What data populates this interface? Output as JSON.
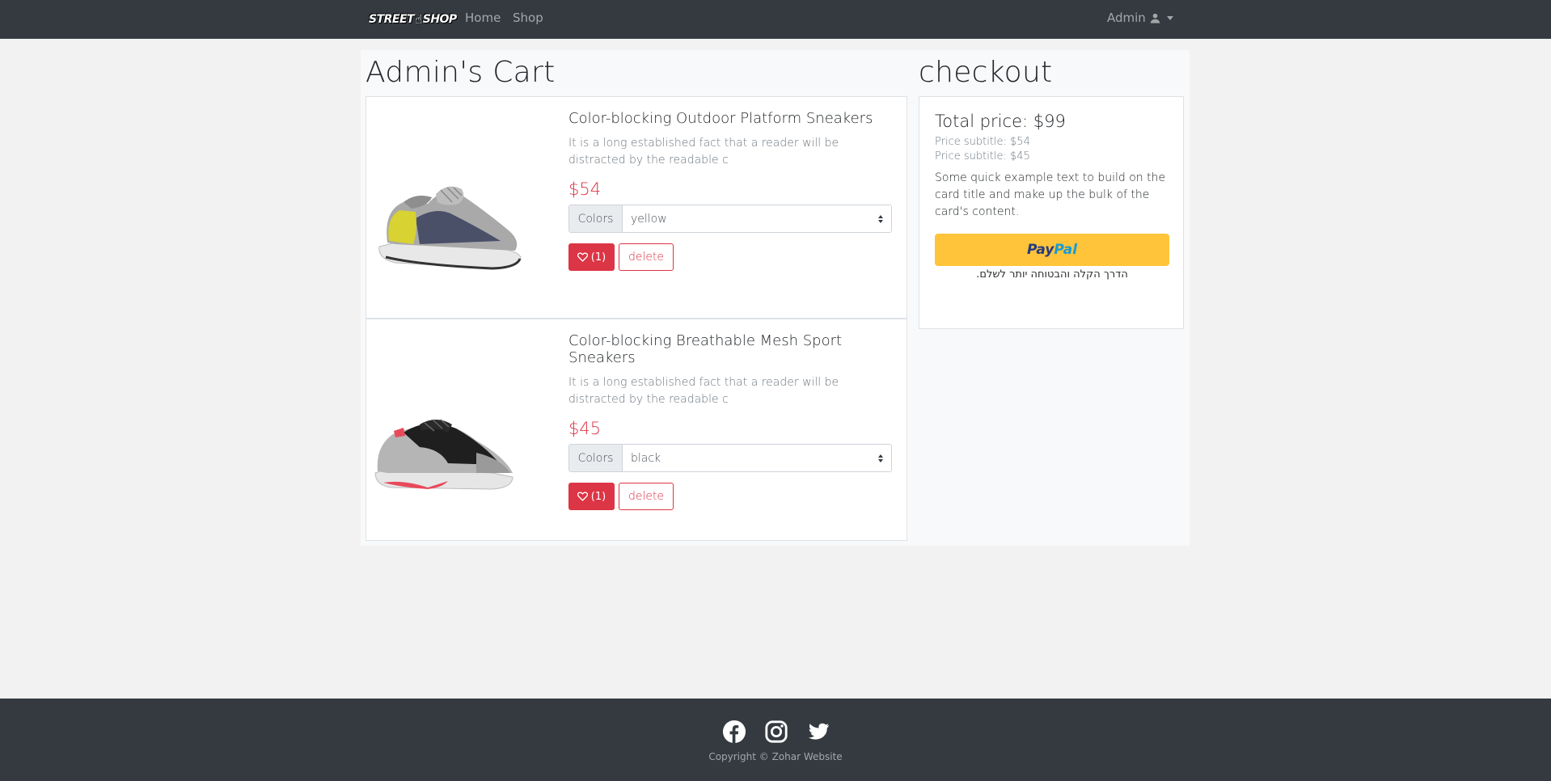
{
  "navbar": {
    "brand": {
      "part1": "STREET",
      "part2": "SHOP"
    },
    "links": [
      {
        "label": "Home"
      },
      {
        "label": "Shop"
      }
    ],
    "user": {
      "label": "Admin",
      "icon": "user-icon"
    }
  },
  "cart": {
    "title": "Admin's Cart",
    "items": [
      {
        "name": "Color-blocking Outdoor Platform Sneakers",
        "description": "It is a long established fact that a reader will be distracted by the readable c",
        "price": "$54",
        "colors_label": "Colors",
        "color_selected": "yellow",
        "likes": "(1)",
        "delete_label": "delete",
        "image": "sneaker-grey-yellow-image"
      },
      {
        "name": "Color-blocking Breathable Mesh Sport Sneakers",
        "description": "It is a long established fact that a reader will be distracted by the readable c",
        "price": "$45",
        "colors_label": "Colors",
        "color_selected": "black",
        "likes": "(1)",
        "delete_label": "delete",
        "image": "sneaker-black-red-image"
      }
    ]
  },
  "checkout": {
    "title": "checkout",
    "total": "Total price: $99",
    "subtitles": [
      "Price subtitle: $54",
      "Price subtitle: $45"
    ],
    "text": "Some quick example text to build on the card title and make up the bulk of the card's content.",
    "paypal": {
      "pay": "Pay",
      "pal": "Pal",
      "tagline": "הדרך הקלה והבטוחה יותר לשלם."
    }
  },
  "footer": {
    "social_icons": [
      "facebook-icon",
      "instagram-icon",
      "twitter-icon"
    ],
    "copyright": "Copyright © Zohar Website"
  },
  "colors": {
    "navbar_bg": "#343a40",
    "danger": "#dc3545",
    "paypal_yellow": "#ffc439"
  }
}
